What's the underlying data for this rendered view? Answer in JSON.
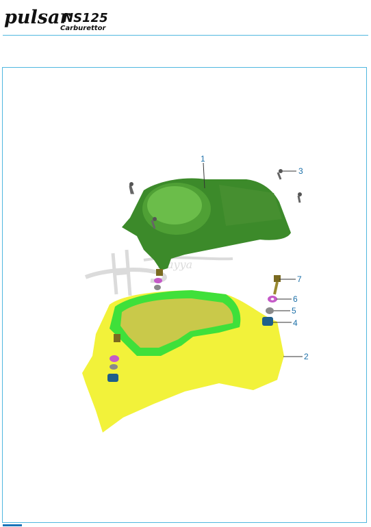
{
  "header": {
    "brand": "pulsar",
    "model": "NS125",
    "variant": "Carburettor"
  },
  "watermark": {
    "text": "Hayya"
  },
  "callouts": [
    {
      "label": "1"
    },
    {
      "label": "2"
    },
    {
      "label": "3"
    },
    {
      "label": "4"
    },
    {
      "label": "5"
    },
    {
      "label": "6"
    },
    {
      "label": "7"
    }
  ],
  "colors": {
    "accent": "#4fb7df",
    "callout": "#1b6fa8",
    "upper_cover": "#3c8a2a",
    "lower_cover": "#f2f23a",
    "gasket": "#3fe03a",
    "washer": "#c55ac8",
    "grommet": "#1f5f8a"
  }
}
